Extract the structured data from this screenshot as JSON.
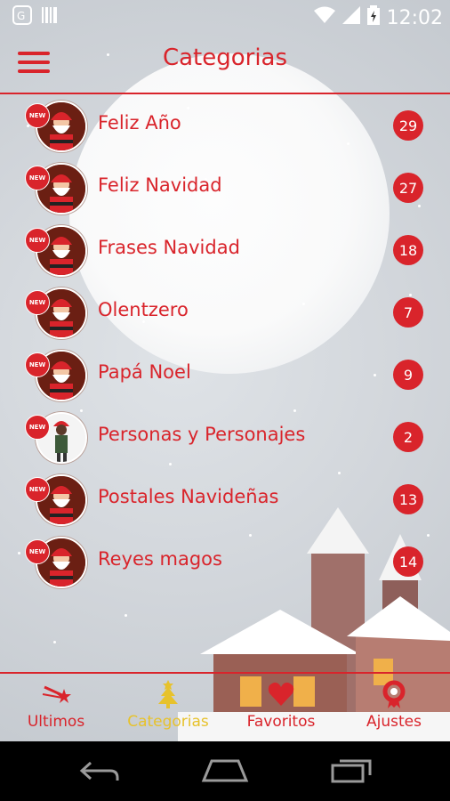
{
  "status": {
    "time": "12:02"
  },
  "header": {
    "title": "Categorias"
  },
  "badge_text": "NEW",
  "categories": [
    {
      "label": "Feliz Año",
      "count": "29"
    },
    {
      "label": "Feliz Navidad",
      "count": "27"
    },
    {
      "label": "Frases Navidad",
      "count": "18"
    },
    {
      "label": "Olentzero",
      "count": "7"
    },
    {
      "label": "Papá Noel",
      "count": "9"
    },
    {
      "label": "Personas y Personajes",
      "count": "2"
    },
    {
      "label": "Postales Navideñas",
      "count": "13"
    },
    {
      "label": "Reyes magos",
      "count": "14"
    }
  ],
  "nav": [
    {
      "label": "Ultimos",
      "icon": "shooting-star-icon"
    },
    {
      "label": "Categorias",
      "icon": "tree-icon",
      "active": true
    },
    {
      "label": "Favoritos",
      "icon": "heart-icon"
    },
    {
      "label": "Ajustes",
      "icon": "wreath-icon"
    }
  ],
  "colors": {
    "accent": "#d9242b",
    "active": "#e7c22c"
  }
}
